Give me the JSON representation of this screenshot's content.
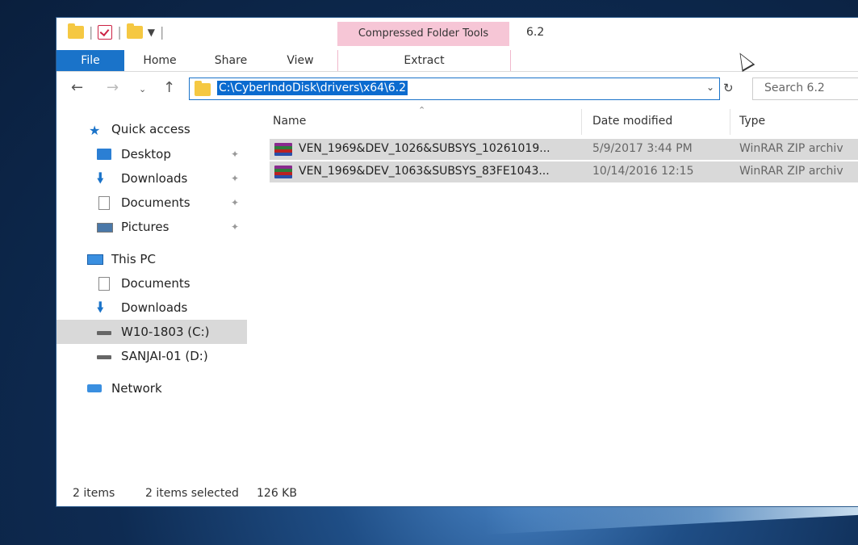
{
  "window": {
    "title": "6.2",
    "contextual_tab_group": "Compressed Folder Tools",
    "tabs": [
      "File",
      "Home",
      "Share",
      "View",
      "Extract"
    ]
  },
  "address": {
    "path": "C:\\CyberIndoDisk\\drivers\\x64\\6.2",
    "search_placeholder": "Search 6.2"
  },
  "sidebar": {
    "items": [
      {
        "label": "Quick access",
        "icon": "star-icon"
      },
      {
        "label": "Desktop",
        "icon": "desktop-icon",
        "pinned": true
      },
      {
        "label": "Downloads",
        "icon": "download-icon",
        "pinned": true
      },
      {
        "label": "Documents",
        "icon": "documents-icon",
        "pinned": true
      },
      {
        "label": "Pictures",
        "icon": "pictures-icon",
        "pinned": true
      },
      {
        "label": "This PC",
        "icon": "pc-icon"
      },
      {
        "label": "Documents",
        "icon": "documents-icon"
      },
      {
        "label": "Downloads",
        "icon": "download-icon"
      },
      {
        "label": "W10-1803 (C:)",
        "icon": "drive-icon",
        "selected": true
      },
      {
        "label": "SANJAI-01 (D:)",
        "icon": "drive-icon"
      },
      {
        "label": "Network",
        "icon": "network-icon"
      }
    ]
  },
  "columns": {
    "name": "Name",
    "date": "Date modified",
    "type": "Type"
  },
  "files": [
    {
      "name": "VEN_1969&DEV_1026&SUBSYS_10261019...",
      "date": "5/9/2017 3:44 PM",
      "type": "WinRAR ZIP archiv"
    },
    {
      "name": "VEN_1969&DEV_1063&SUBSYS_83FE1043...",
      "date": "10/14/2016 12:15",
      "type": "WinRAR ZIP archiv"
    }
  ],
  "status": {
    "count": "2 items",
    "selected": "2 items selected",
    "size": "126 KB"
  },
  "colors": {
    "accent": "#1a73c9",
    "contextual": "#f6c6d6",
    "selection": "#d9d9d9"
  }
}
